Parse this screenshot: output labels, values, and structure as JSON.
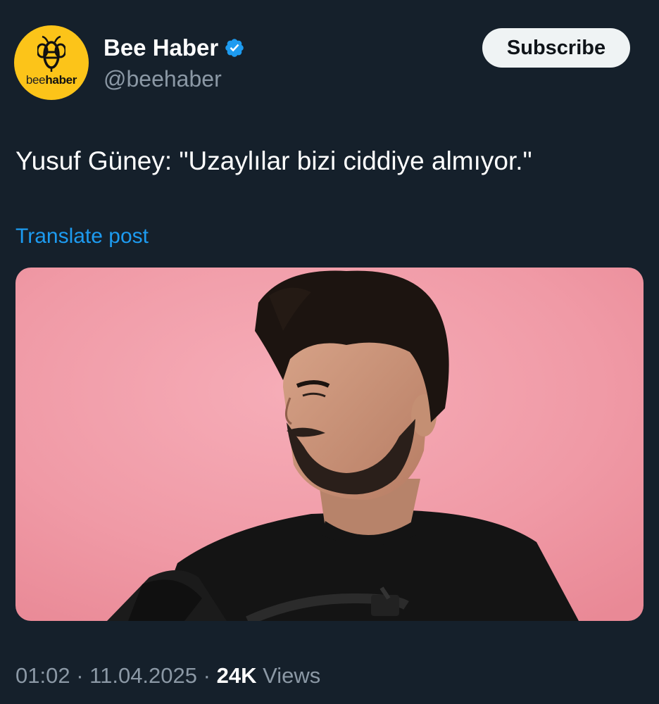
{
  "account": {
    "display_name": "Bee Haber",
    "handle": "@beehaber",
    "verified": true,
    "avatar": {
      "logo_text_light": "bee",
      "logo_text_bold": "haber",
      "background_color": "#fcc419",
      "icon": "bee-icon"
    }
  },
  "actions": {
    "subscribe_label": "Subscribe"
  },
  "post": {
    "text": "Yusuf Güney: \"Uzaylılar bizi ciddiye almıyor.\"",
    "translate_label": "Translate post",
    "media_description_icon": "photo"
  },
  "meta": {
    "time": "01:02",
    "separator": "·",
    "date": "11.04.2025",
    "views_count": "24K",
    "views_label": "Views"
  },
  "colors": {
    "background": "#15202b",
    "accent_link": "#1d9bf0",
    "verified_badge": "#1d9bf0",
    "secondary_text": "#8b98a5",
    "media_background": "#f2a2ad"
  }
}
